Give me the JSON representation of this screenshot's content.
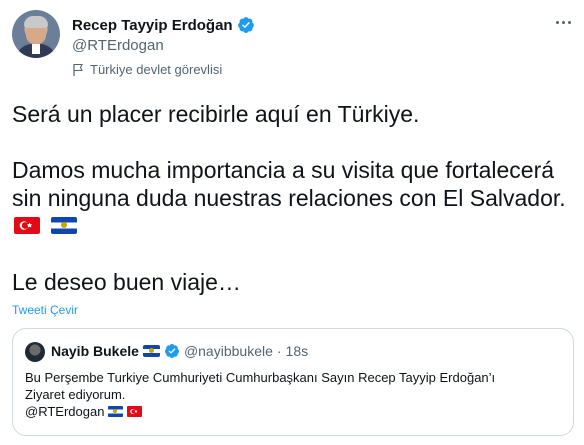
{
  "author": {
    "display_name": "Recep Tayyip Erdoğan",
    "handle": "@RTErdogan",
    "account_label": "Türkiye devlet görevlisi"
  },
  "tweet": {
    "line1": "Será un placer recibirle aquí en Türkiye.",
    "line2": "Damos mucha importancia a su visita que fortalecerá sin ninguna duda nuestras relaciones con El Salvador.",
    "line3": "Le deseo buen viaje…",
    "flags": [
      "flag-turkey",
      "flag-el-salvador"
    ],
    "translate_label": "Tweeti Çevir"
  },
  "quoted": {
    "display_name": "Nayib Bukele",
    "handle": "@nayibbukele",
    "separator": "·",
    "time": "18s",
    "text_line1": "Bu Perşembe Turkiye Cumhuriyeti Cumhurbaşkanı Sayın Recep Tayyip Erdoğan’ı",
    "text_line2": "Ziyaret ediyorum.",
    "mention": "@RTErdogan"
  },
  "colors": {
    "text": "#0f1419",
    "secondary": "#536471",
    "link": "#1d9bf0",
    "verified": "#1d9bf0",
    "border": "#cfd9de"
  }
}
